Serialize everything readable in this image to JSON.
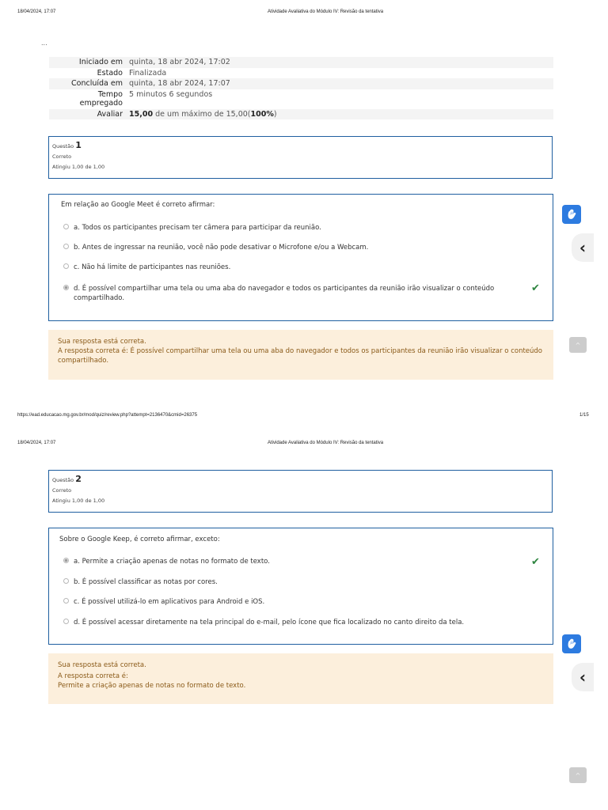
{
  "page1": {
    "print_date": "18/04/2024, 17:07",
    "doc_title": "Atividade Avaliativa do Módulo IV: Revisão da tentativa",
    "ellipsis": "...",
    "footer_url": "https://ead.educacao.mg.gov.br/mod/quiz/review.php?attempt=2136470&cmid=26375",
    "page_number": "1/15"
  },
  "page2": {
    "print_date": "18/04/2024, 17:07",
    "doc_title": "Atividade Avaliativa do Módulo IV: Revisão da tentativa"
  },
  "summary": {
    "started_label": "Iniciado em",
    "started_value": "quinta, 18 abr 2024, 17:02",
    "state_label": "Estado",
    "state_value": "Finalizada",
    "completed_label": "Concluída em",
    "completed_value": "quinta, 18 abr 2024, 17:07",
    "time_label_1": "Tempo",
    "time_label_2": "empregado",
    "time_value": "5 minutos 6 segundos",
    "grade_label": "Avaliar",
    "grade_score": "15,00",
    "grade_mid": " de um máximo de ",
    "grade_max": "15,00(",
    "grade_pct": "100%",
    "grade_close": ")"
  },
  "q1": {
    "question_word": "Questão ",
    "number": "1",
    "status": "Correto",
    "marks": "Atingiu 1,00 de 1,00",
    "text": "Em relação ao Google Meet é correto afirmar:",
    "options": [
      "a. Todos os participantes precisam ter câmera para participar da reunião.",
      "b. Antes de ingressar na reunião, você não pode desativar o Microfone e/ou a Webcam.",
      "c. Não há limite de participantes nas reuniões.",
      "d. É possível compartilhar uma tela ou uma aba do navegador e todos os participantes da reunião irão visualizar o conteúdo compartilhado."
    ],
    "feedback_1": "Sua resposta está correta.",
    "feedback_2": "A resposta correta é: É possível compartilhar uma tela ou uma aba do navegador e todos os participantes da reunião irão visualizar o conteúdo compartilhado."
  },
  "q2": {
    "question_word": "Questão ",
    "number": "2",
    "status": "Correto",
    "marks": "Atingiu 1,00 de 1,00",
    "text": "Sobre o Google Keep, é correto afirmar, exceto:",
    "options": [
      "a. Permite a criação apenas de notas no formato de texto.",
      "b. É possível classificar as notas por cores.",
      "c. É possível utilizá-lo em aplicativos para Android e iOS.",
      "d. É possível acessar diretamente na tela principal do e-mail, pelo ícone que fica localizado no canto direito da tela."
    ],
    "feedback_1": "Sua resposta está correta.",
    "feedback_2": "A resposta correta é:",
    "feedback_3": "Permite a criação apenas de notas no formato de texto."
  },
  "icons": {
    "check": "✔",
    "chevron_left": "‹",
    "caret_up": "^",
    "accessibility": "accessibility-hand-icon"
  },
  "colors": {
    "accent": "#1f5fa0",
    "check": "#2e8540",
    "feedback_bg": "#fcefdc",
    "feedback_text": "#8a5a18",
    "vlibras": "#2d7be0"
  }
}
